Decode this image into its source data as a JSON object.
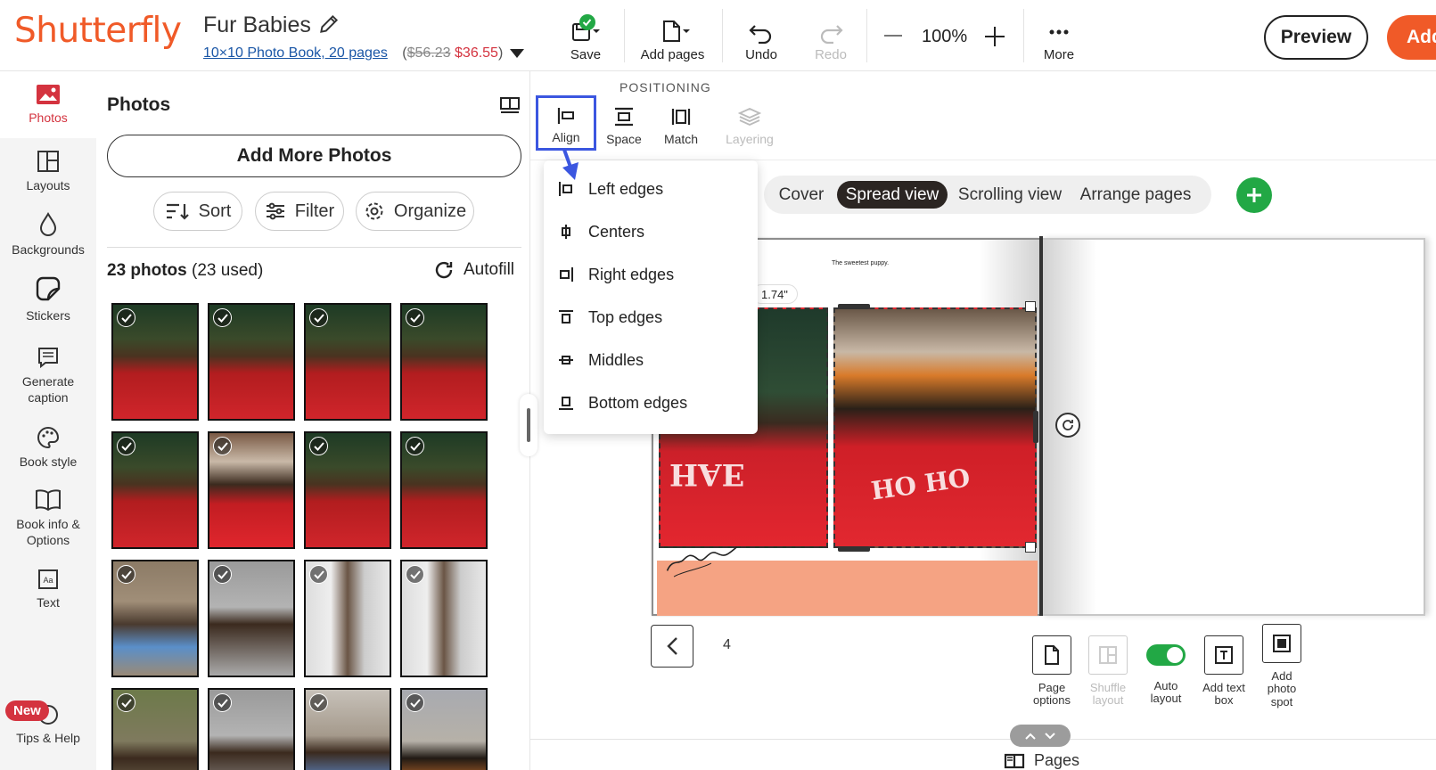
{
  "app": {
    "logo_text": "Shutterfly",
    "brand_color": "#f05a28",
    "accent_color": "#3b56e0"
  },
  "project": {
    "name": "Fur Babies",
    "product_link": "10×10 Photo Book, 20 pages",
    "price_open": "(",
    "old_price": "$56.23",
    "new_price": "$36.55",
    "price_close": ")"
  },
  "toolbar": {
    "save": "Save",
    "add_pages": "Add pages",
    "undo": "Undo",
    "redo": "Redo",
    "zoom": "100%",
    "more": "More",
    "preview": "Preview",
    "add_to_cart": "Add"
  },
  "leftnav": {
    "items": [
      {
        "label": "Photos",
        "icon": "photo-icon",
        "active": true
      },
      {
        "label": "Layouts",
        "icon": "layout-icon"
      },
      {
        "label": "Backgrounds",
        "icon": "droplet-icon"
      },
      {
        "label": "Stickers",
        "icon": "sticker-icon"
      },
      {
        "label": "Generate caption",
        "icon": "caption-icon"
      },
      {
        "label": "Book style",
        "icon": "palette-icon"
      },
      {
        "label": "Book info & Options",
        "icon": "book-icon"
      },
      {
        "label": "Text",
        "icon": "text-icon"
      },
      {
        "label": "Tips & Help",
        "icon": "help-icon"
      }
    ],
    "new_badge": "New"
  },
  "photos_panel": {
    "title": "Photos",
    "add_more": "Add More Photos",
    "sort": "Sort",
    "filter": "Filter",
    "organize": "Organize",
    "count": "23 photos",
    "used": " (23 used)",
    "autofill": "Autofill"
  },
  "positioning": {
    "label": "POSITIONING",
    "align": "Align",
    "space": "Space",
    "match": "Match",
    "layering": "Layering"
  },
  "align_menu": {
    "items": [
      "Left edges",
      "Centers",
      "Right edges",
      "Top edges",
      "Middles",
      "Bottom edges"
    ]
  },
  "view_tabs": {
    "cover": "Cover",
    "spread": "Spread view",
    "scrolling": "Scrolling view",
    "arrange": "Arrange pages"
  },
  "spread": {
    "caption": "The sweetest puppy.",
    "dimension": "1.74\"",
    "script_text": "Christmas memories",
    "page_number": "4"
  },
  "bottom_tools": {
    "page_options": "Page options",
    "shuffle": "Shuffle layout",
    "auto_layout": "Auto layout",
    "add_text_box": "Add text box",
    "add_photo_spot": "Add photo spot"
  },
  "pages_label": "Pages"
}
